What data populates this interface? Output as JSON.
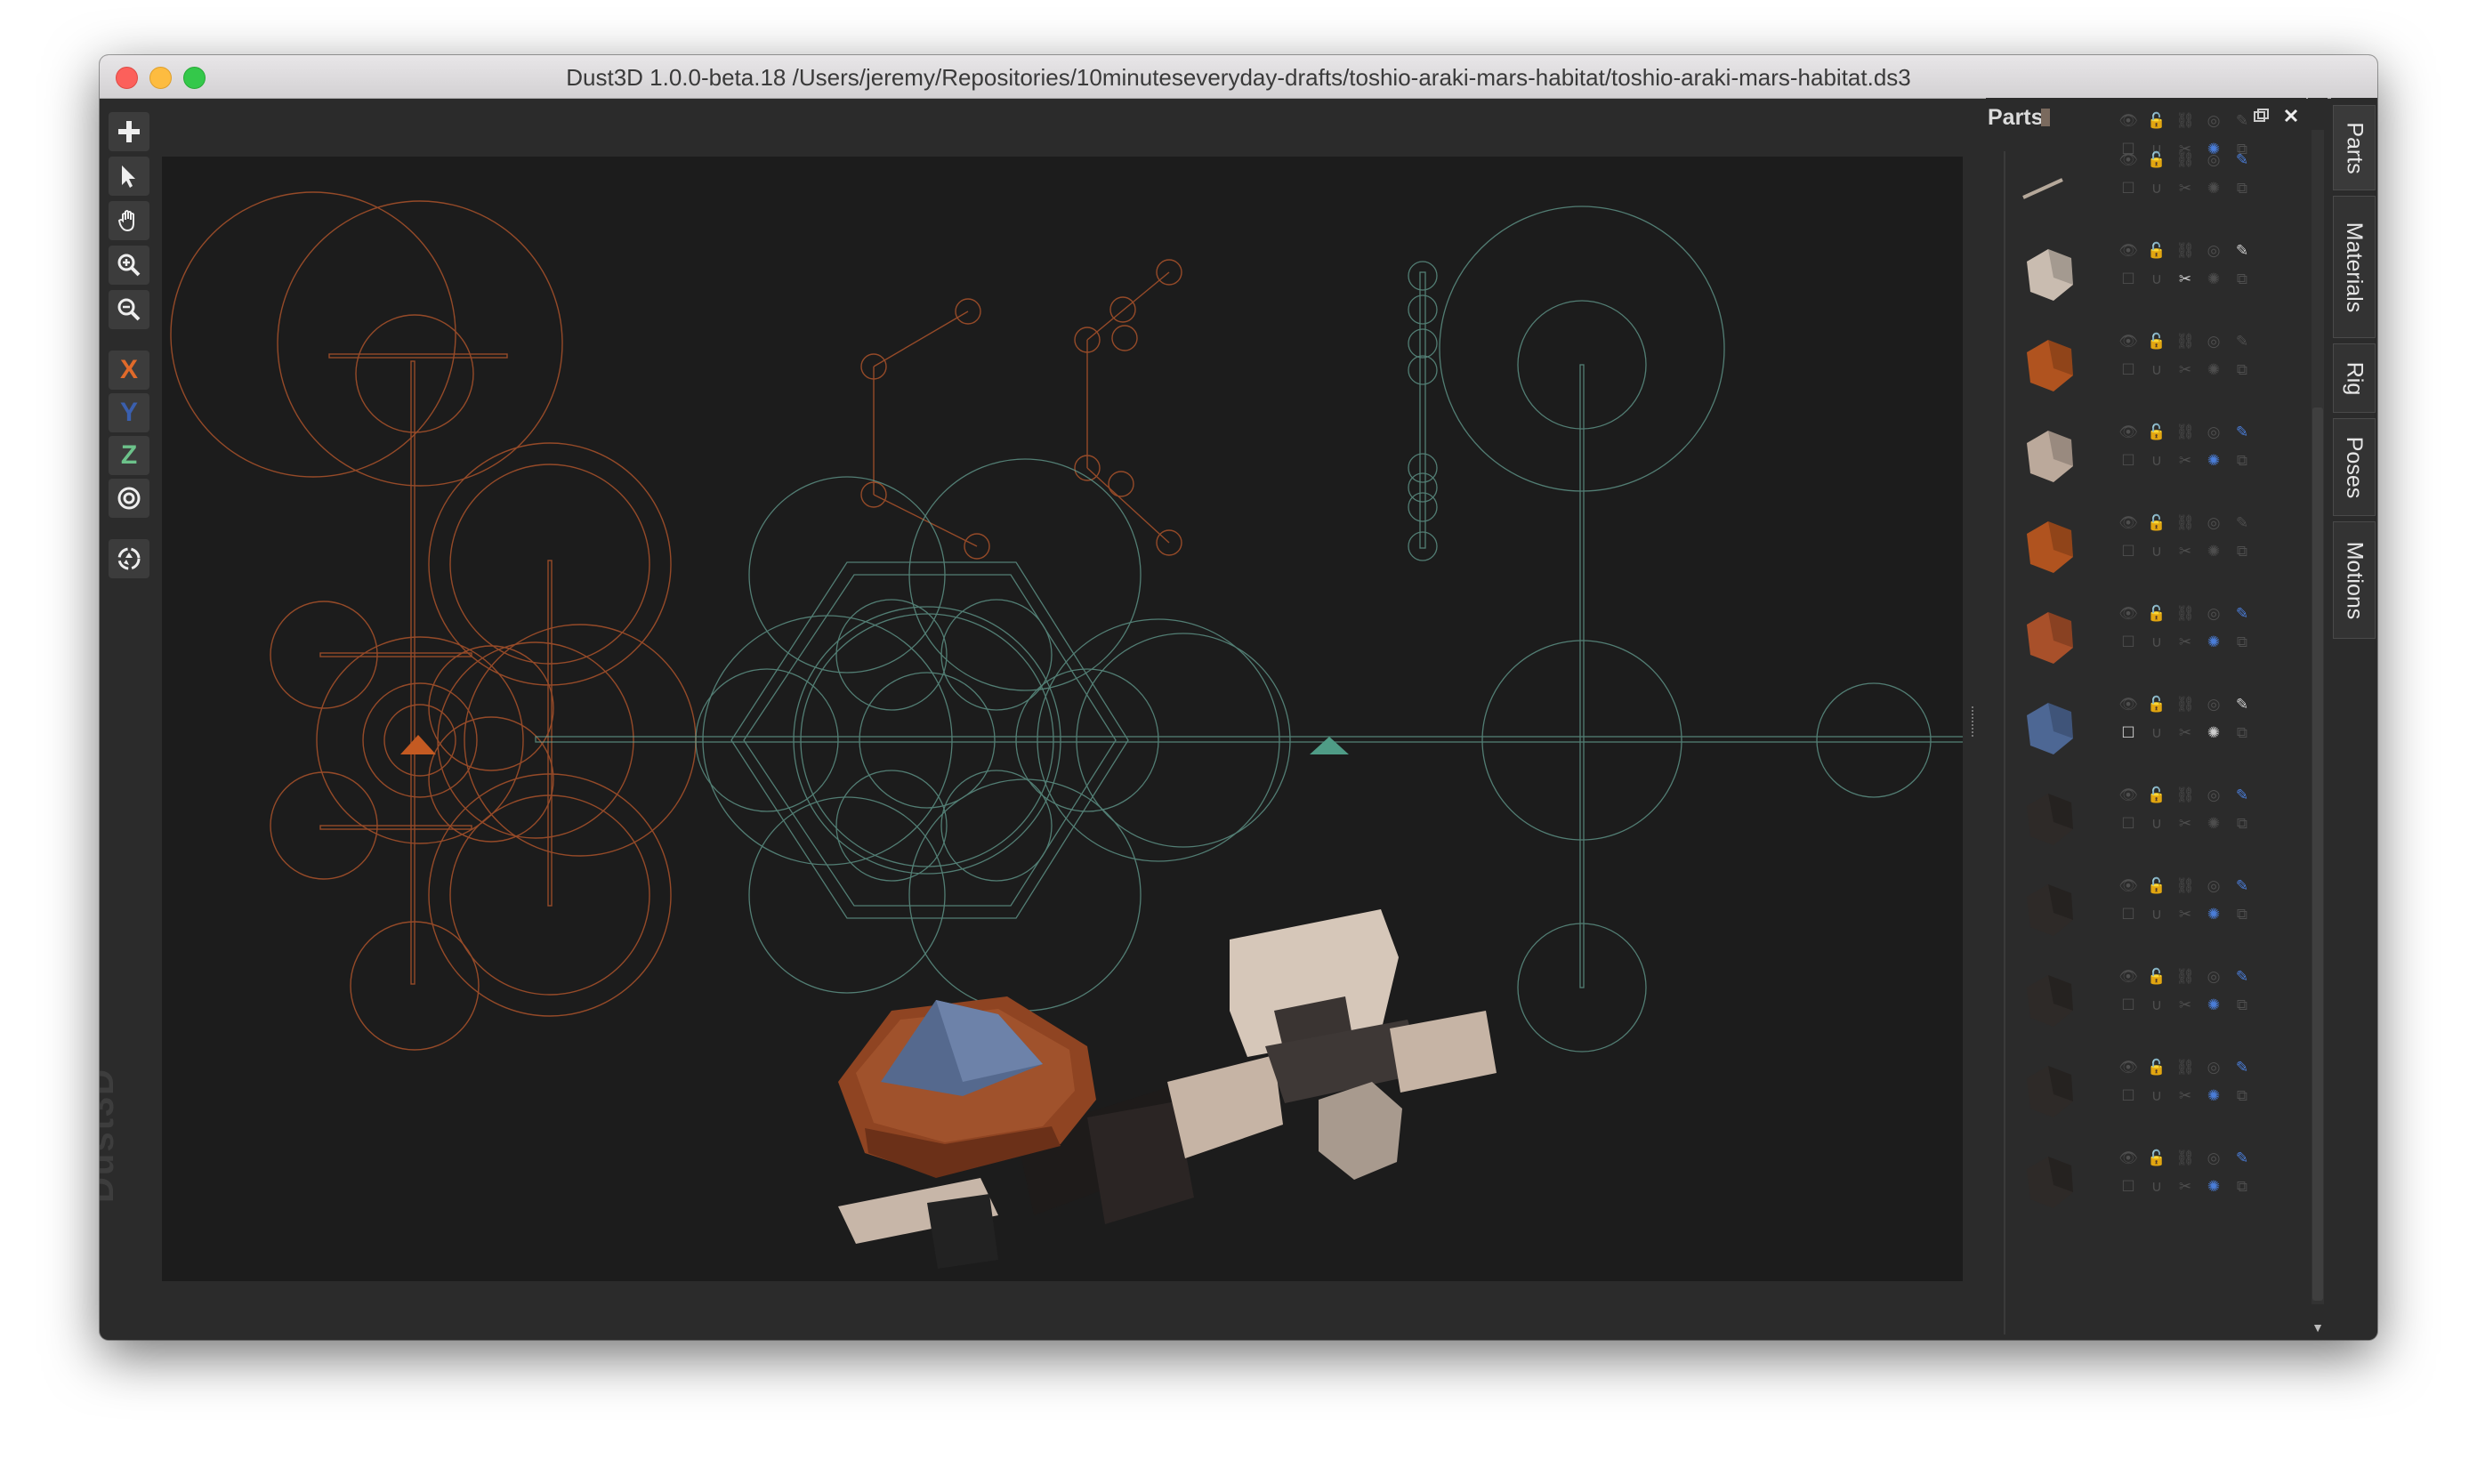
{
  "window": {
    "title": "Dust3D 1.0.0-beta.18 /Users/jeremy/Repositories/10minuteseveryday-drafts/toshio-araki-mars-habitat/toshio-araki-mars-habitat.ds3"
  },
  "toolbar": {
    "tools": [
      {
        "name": "add-tool-icon"
      },
      {
        "name": "select-tool-icon"
      },
      {
        "name": "drag-hand-tool-icon"
      },
      {
        "name": "zoom-in-tool-icon"
      },
      {
        "name": "zoom-out-tool-icon"
      }
    ],
    "axis": {
      "x_label": "X",
      "y_label": "Y",
      "z_label": "Z",
      "x_color": "#e06a2a",
      "y_color": "#3a5fae",
      "z_color": "#6cc28a"
    },
    "extra_tools": [
      {
        "name": "radius-lock-icon"
      },
      {
        "name": "regenerate-icon"
      }
    ]
  },
  "canvas": {
    "brand": "Dust3D",
    "guide_colors": {
      "orange": "#b4562c",
      "teal": "#6aa89a"
    }
  },
  "parts_panel": {
    "header": "Parts",
    "rows": [
      {
        "thumb": "small-post",
        "color": "#7a6a5e",
        "states": [
          "",
          "",
          "",
          "on",
          ""
        ]
      },
      {
        "thumb": "line-strut",
        "color": "#b5a89a",
        "states": [
          "",
          "",
          "",
          "",
          "on"
        ]
      },
      {
        "thumb": "beige-rock",
        "color": "#c9bcb0",
        "states": [
          "",
          "",
          "white",
          "",
          "white"
        ]
      },
      {
        "thumb": "orange-bracket",
        "color": "#b0531f",
        "states": [
          "",
          "",
          "",
          "",
          ""
        ]
      },
      {
        "thumb": "beige-boulder",
        "color": "#bba99b",
        "states": [
          "",
          "",
          "",
          "on",
          "on"
        ]
      },
      {
        "thumb": "orange-elbow",
        "color": "#b0531f",
        "states": [
          "",
          "",
          "",
          "",
          ""
        ]
      },
      {
        "thumb": "orange-dome",
        "color": "#a8502a",
        "states": [
          "",
          "",
          "",
          "on",
          "on"
        ]
      },
      {
        "thumb": "blue-gem",
        "color": "#4d6794",
        "states": [
          "white",
          "",
          "",
          "white",
          "white"
        ]
      },
      {
        "thumb": "dark-cube",
        "color": "#2e2a28",
        "states": [
          "",
          "",
          "",
          "",
          "on"
        ]
      },
      {
        "thumb": "dark-wedge",
        "color": "#2e2a28",
        "states": [
          "",
          "",
          "",
          "on",
          "on"
        ]
      },
      {
        "thumb": "dark-block",
        "color": "#2e2a28",
        "states": [
          "",
          "",
          "",
          "on",
          "on"
        ]
      },
      {
        "thumb": "dark-slab",
        "color": "#2e2a28",
        "states": [
          "",
          "",
          "",
          "on",
          "on"
        ]
      },
      {
        "thumb": "dark-shard",
        "color": "#2e2a28",
        "states": [
          "",
          "",
          "",
          "on",
          "on"
        ]
      }
    ]
  },
  "side_tabs": [
    "Parts",
    "Materials",
    "Rig",
    "Poses",
    "Motions"
  ]
}
